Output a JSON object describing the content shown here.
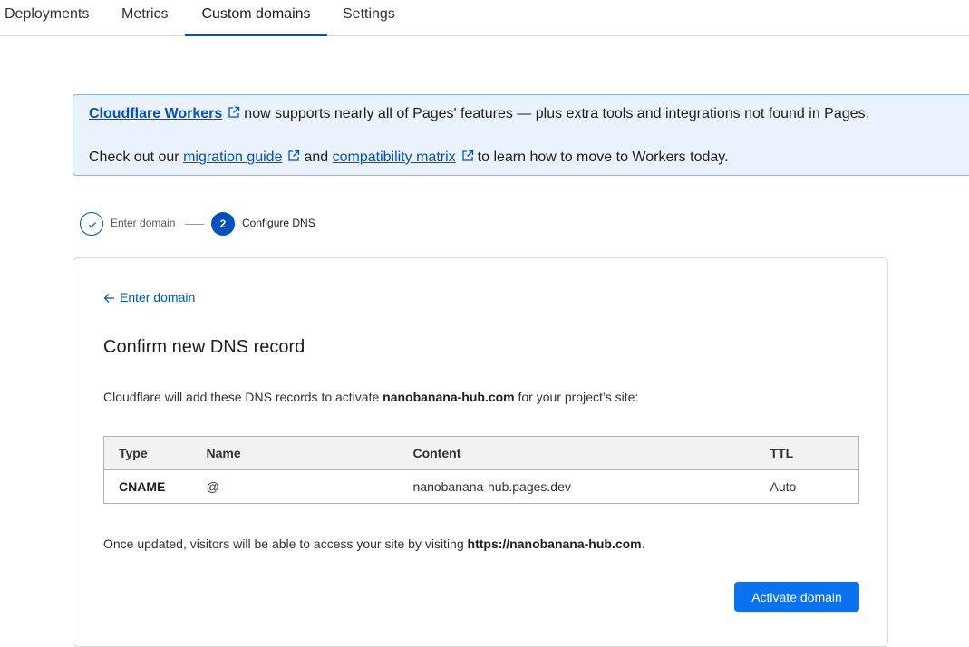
{
  "tabs": [
    {
      "label": "Deployments",
      "active": false
    },
    {
      "label": "Metrics",
      "active": false
    },
    {
      "label": "Custom domains",
      "active": true
    },
    {
      "label": "Settings",
      "active": false
    }
  ],
  "banner": {
    "workers_link": "Cloudflare Workers",
    "line1_rest": "now supports nearly all of Pages' features — plus extra tools and integrations not found in Pages.",
    "line2_prefix": "Check out our",
    "migration_link": "migration guide",
    "line2_and": "and",
    "compat_link": "compatibility matrix",
    "line2_suffix": "to learn how to move to Workers today.",
    "icon": "external-link-icon"
  },
  "stepper": {
    "step1_label": "Enter domain",
    "step2_number": "2",
    "step2_label": "Configure DNS"
  },
  "card": {
    "back_label": "Enter domain",
    "title": "Confirm new DNS record",
    "desc_prefix": "Cloudflare will add these DNS records to activate",
    "domain": "nanobanana-hub.com",
    "desc_suffix": "for your project’s site:",
    "table": {
      "headers": {
        "type": "Type",
        "name": "Name",
        "content": "Content",
        "ttl": "TTL"
      },
      "rows": [
        {
          "type": "CNAME",
          "name": "@",
          "content": "nanobanana-hub.pages.dev",
          "ttl": "Auto"
        }
      ]
    },
    "footnote_prefix": "Once updated, visitors will be able to access your site by visiting",
    "footnote_url": "https://nanobanana-hub.com",
    "footnote_suffix": ".",
    "activate_label": "Activate domain"
  },
  "colors": {
    "accent": "#0051c3",
    "button": "#0a72ef",
    "banner_bg": "#eaf2fd",
    "banner_border": "#86b4ea"
  }
}
